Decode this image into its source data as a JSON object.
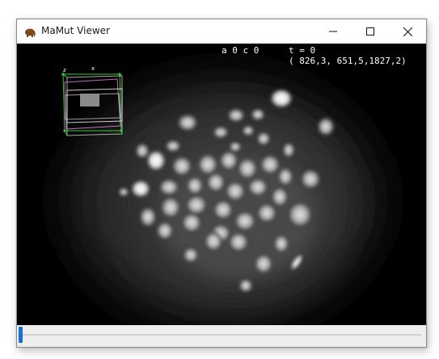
{
  "window": {
    "title": "MaMut Viewer",
    "app_icon": "mammoth-icon",
    "controls": [
      "minimize-icon",
      "maximize-icon",
      "close-icon"
    ]
  },
  "viewer": {
    "channel_info": "a 0 c 0",
    "time_label": "t = 0",
    "coordinates": "( 826,3, 651,5,1827,2)",
    "box_axis_x": "x",
    "box_axis_z": "z"
  },
  "timeline": {
    "position": 0
  },
  "colors": {
    "accent": "#1a6fd6",
    "viewer_background": "#000000",
    "box_outline": "#33cc33"
  }
}
